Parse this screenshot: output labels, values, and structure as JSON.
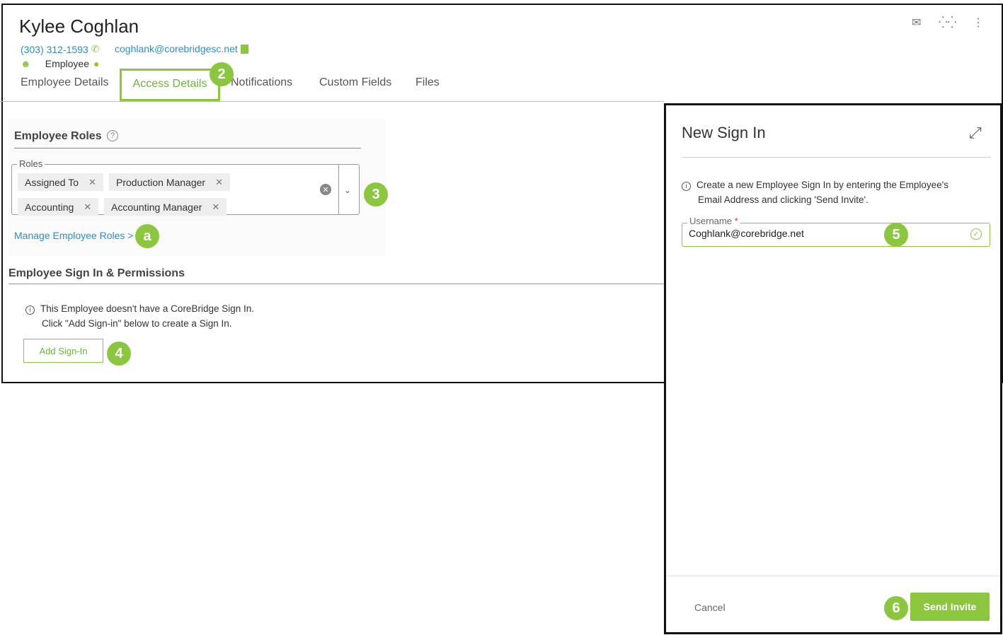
{
  "employee": {
    "name": "Kylee Coghlan",
    "phone": "(303) 312-1593",
    "email": "coghlank@corebridgesc.net",
    "role": "Employee"
  },
  "header_icons": [
    "mail-icon",
    "org-chart-icon",
    "more-vertical-icon"
  ],
  "tabs": [
    {
      "label": "Employee Details"
    },
    {
      "label": "Access Details",
      "active": true
    },
    {
      "label": "Notifications"
    },
    {
      "label": "Custom Fields"
    },
    {
      "label": "Files"
    }
  ],
  "roles_section": {
    "title": "Employee Roles",
    "field_label": "Roles",
    "chips": [
      "Assigned To",
      "Production Manager",
      "Accounting",
      "Accounting Manager"
    ],
    "manage_link": "Manage Employee Roles >"
  },
  "signin_section": {
    "title": "Employee Sign In & Permissions",
    "info_line1": "This Employee doesn't have a CoreBridge Sign In.",
    "info_line2": "Click \"Add Sign-in\" below to create a Sign In.",
    "add_button": "Add Sign-In"
  },
  "panel": {
    "title": "New Sign In",
    "info_line1": "Create a new Employee Sign In by entering the Employee's",
    "info_line2": "Email Address and clicking 'Send Invite'.",
    "username_label": "Username",
    "required_mark": "*",
    "username_value": "Coghlank@corebridge.net",
    "cancel": "Cancel",
    "send": "Send Invite"
  },
  "callouts": {
    "tab": "2",
    "roles": "3",
    "add_signin": "4",
    "username": "5",
    "send": "6",
    "manage": "a"
  },
  "colors": {
    "accent": "#8cc63f",
    "link": "#2a8fc8"
  }
}
